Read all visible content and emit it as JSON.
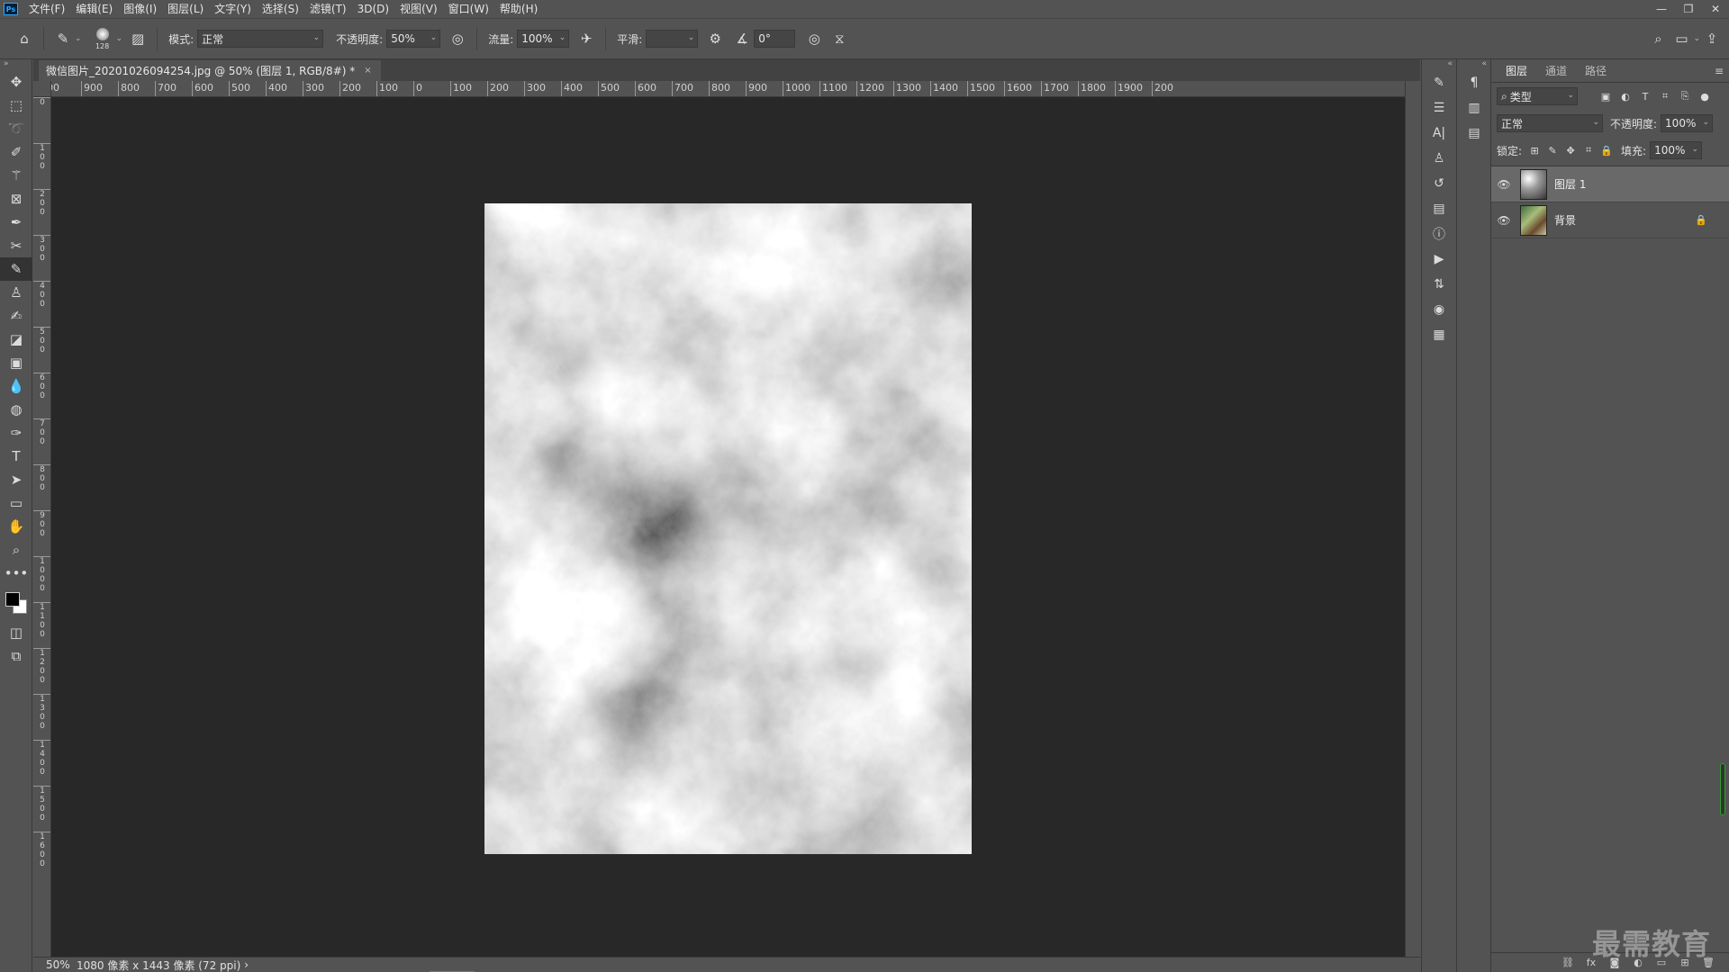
{
  "menubar": {
    "app_logo": "Ps",
    "items": [
      "文件(F)",
      "编辑(E)",
      "图像(I)",
      "图层(L)",
      "文字(Y)",
      "选择(S)",
      "滤镜(T)",
      "3D(D)",
      "视图(V)",
      "窗口(W)",
      "帮助(H)"
    ],
    "window_controls": [
      "minimize-icon",
      "restore-icon",
      "close-icon"
    ]
  },
  "options": {
    "brush_size": "128",
    "mode_label": "模式:",
    "mode_value": "正常",
    "opacity_label": "不透明度:",
    "opacity_value": "50%",
    "flow_label": "流量:",
    "flow_value": "100%",
    "smooth_label": "平滑:",
    "smooth_value": "",
    "angle_value": "0°"
  },
  "tools": [
    "move-tool-icon",
    "marquee-tool-icon",
    "lasso-tool-icon",
    "quick-select-tool-icon",
    "magic-wand-tool-icon",
    "frame-tool-icon",
    "eyedropper-tool-icon",
    "crop-tool-icon",
    "brush-tool-icon",
    "stamp-tool-icon",
    "history-brush-tool-icon",
    "eraser-tool-icon",
    "gradient-tool-icon",
    "blur-tool-icon",
    "dodge-tool-icon",
    "pen-tool-icon",
    "type-tool-icon",
    "path-select-tool-icon",
    "rectangle-tool-icon",
    "hand-tool-icon",
    "zoom-tool-icon",
    "more-tools-icon"
  ],
  "document": {
    "tab_title": "微信图片_20201026094254.jpg @ 50% (图层 1, RGB/8#) *",
    "close": "×"
  },
  "ruler_top": [
    "00",
    "900",
    "800",
    "700",
    "600",
    "500",
    "400",
    "300",
    "200",
    "100",
    "0",
    "100",
    "200",
    "300",
    "400",
    "500",
    "600",
    "700",
    "800",
    "900",
    "1000",
    "1100",
    "1200",
    "1300",
    "1400",
    "1500",
    "1600",
    "1700",
    "1800",
    "1900",
    "200"
  ],
  "ruler_left": [
    "0",
    "1 0 0",
    "2 0 0",
    "3 0 0",
    "4 0 0",
    "5 0 0",
    "6 0 0",
    "7 0 0",
    "8 0 0",
    "9 0 0",
    "1 0 0 0",
    "1 1 0 0",
    "1 2 0 0",
    "1 3 0 0",
    "1 4 0 0",
    "1 5 0 0",
    "1 6 0 0"
  ],
  "statusbar": {
    "zoom": "50%",
    "info": "1080 像素 x 1443 像素 (72 ppi)",
    "arrow": "›"
  },
  "layers_panel": {
    "tabs": [
      "图层",
      "通道",
      "路径"
    ],
    "filter_value": "类型",
    "blend_mode": "正常",
    "opacity_label": "不透明度:",
    "opacity_value": "100%",
    "lock_label": "锁定:",
    "fill_label": "填充:",
    "fill_value": "100%",
    "layers": [
      {
        "name": "图层 1",
        "visible": true,
        "selected": true
      },
      {
        "name": "背景",
        "visible": true,
        "locked": true
      }
    ]
  },
  "watermark": "最需教育",
  "colors": {
    "foreground": "#000000",
    "background": "#ffffff",
    "accent": "#31a8ff"
  }
}
